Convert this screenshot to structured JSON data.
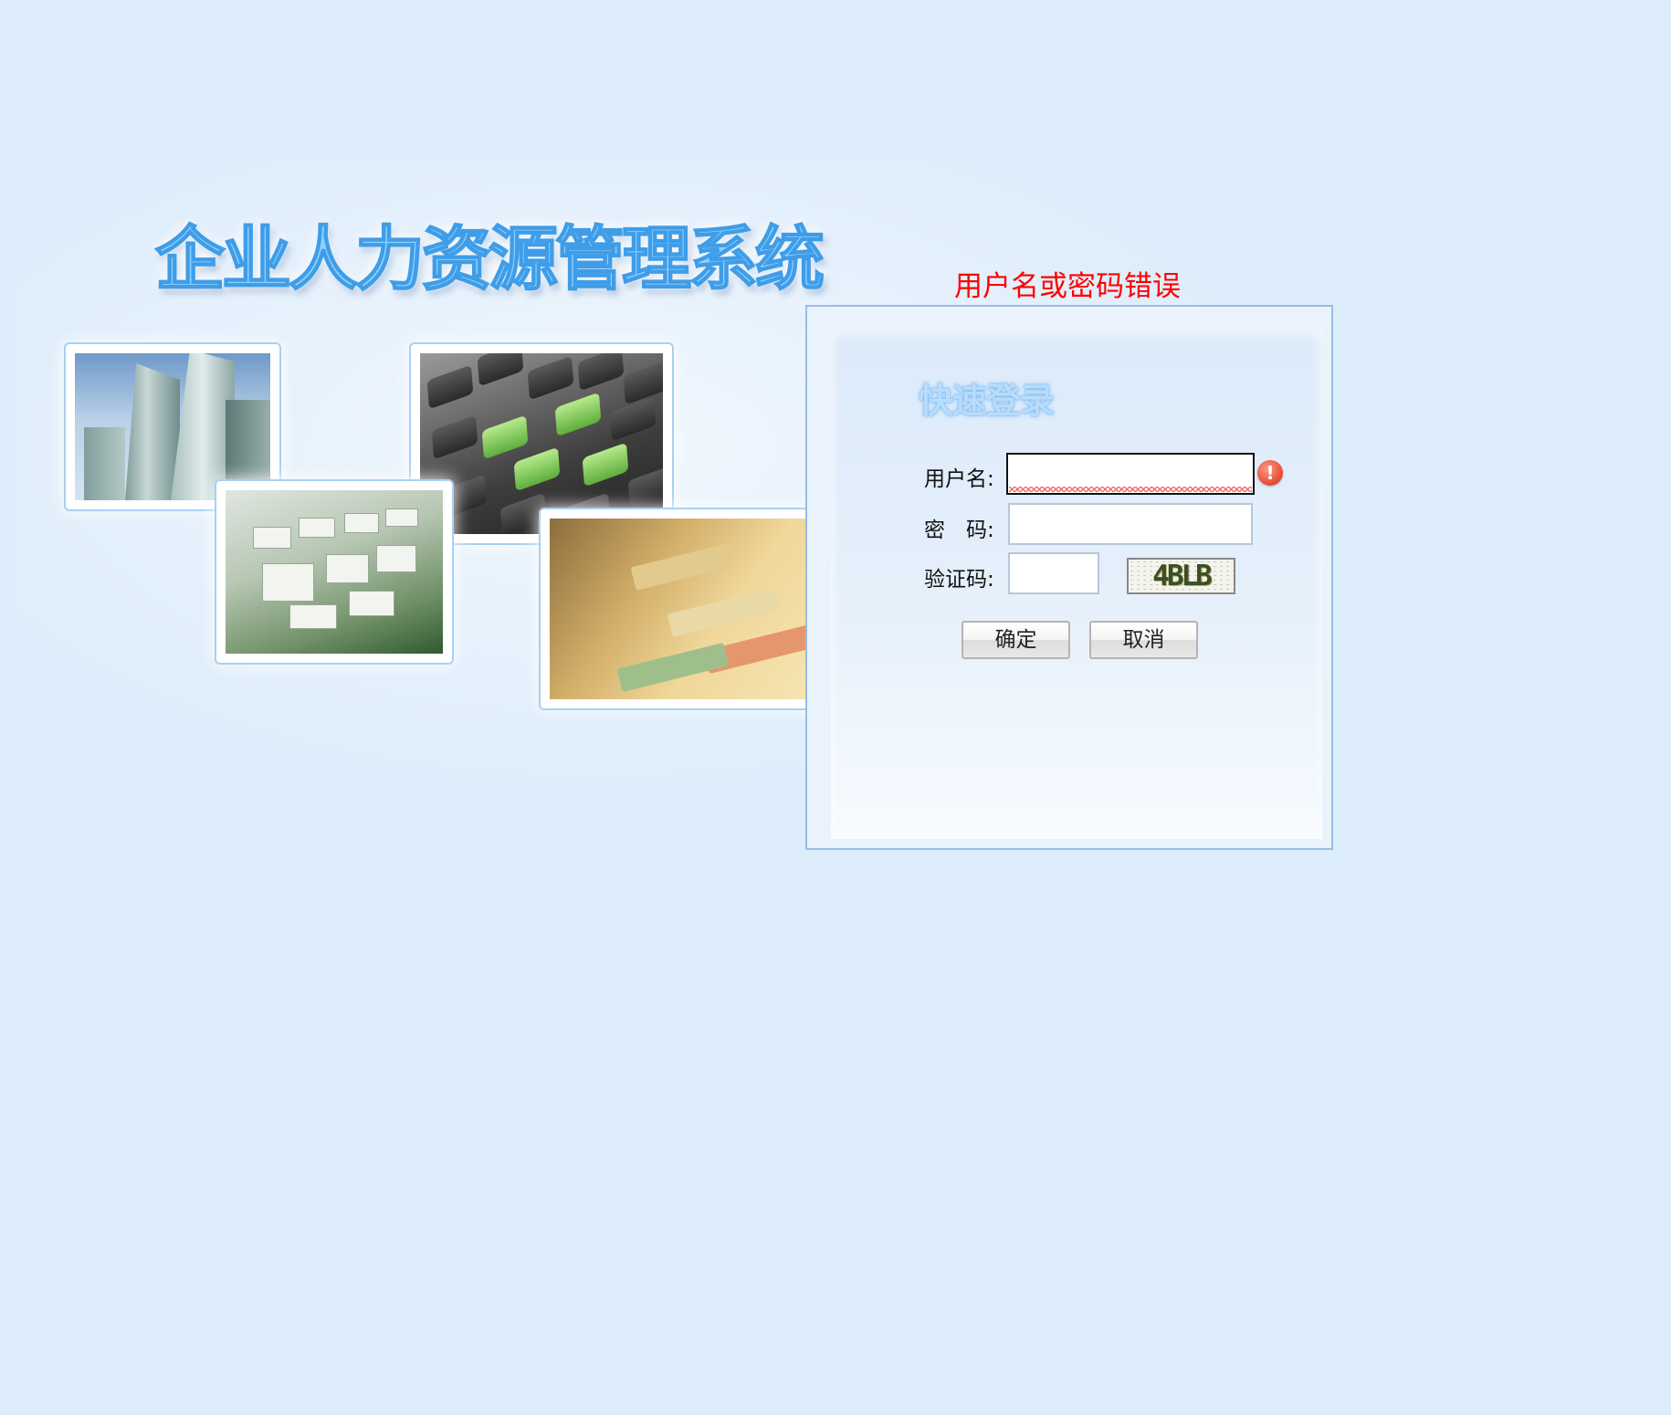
{
  "header": {
    "title": "企业人力资源管理系统"
  },
  "error_message": "用户名或密码错误",
  "login": {
    "title": "快速登录",
    "username_label": "用户名:",
    "username_value": "",
    "password_label": "密　码:",
    "password_value": "",
    "captcha_label": "验证码:",
    "captcha_value": "",
    "captcha_text": "4BLB",
    "confirm_label": "确定",
    "cancel_label": "取消"
  },
  "colors": {
    "background": "#deedfb",
    "error": "#ff0000",
    "title": "#3f9de8"
  },
  "icons": {
    "warning": "exclamation-circle-icon"
  }
}
